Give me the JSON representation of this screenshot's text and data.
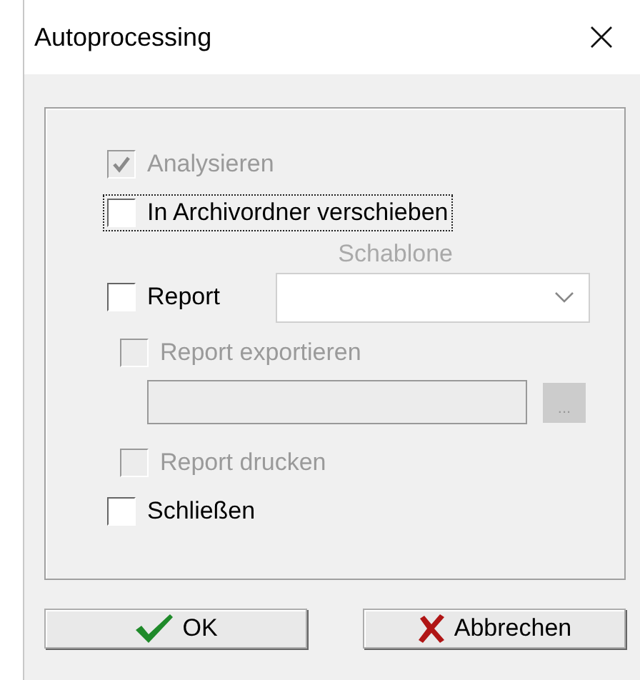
{
  "window": {
    "title": "Autoprocessing"
  },
  "options": [
    {
      "kind": "checkbox",
      "label": "Analysieren",
      "checked": true,
      "disabled": true,
      "focused": false
    },
    {
      "kind": "checkbox",
      "label": "In Archivordner verschieben",
      "checked": false,
      "disabled": false,
      "focused": true
    },
    {
      "kind": "template",
      "label": "Report",
      "checked": false,
      "disabled": false,
      "focused": false,
      "template_label": "Schablone",
      "children": [
        {
          "kind": "checkbox",
          "label": "Report exportieren",
          "checked": false,
          "disabled": true,
          "focused": false
        },
        {
          "kind": "path",
          "disabled": true,
          "browse_label": "..."
        },
        {
          "kind": "checkbox",
          "label": "Report drucken",
          "checked": false,
          "disabled": true,
          "focused": false
        }
      ]
    },
    {
      "kind": "checkbox",
      "label": "Schließen",
      "checked": false,
      "disabled": false,
      "focused": false
    }
  ],
  "buttons": [
    {
      "kind": "ok",
      "label": "OK"
    },
    {
      "kind": "cancel",
      "label": "Abbrechen"
    }
  ]
}
